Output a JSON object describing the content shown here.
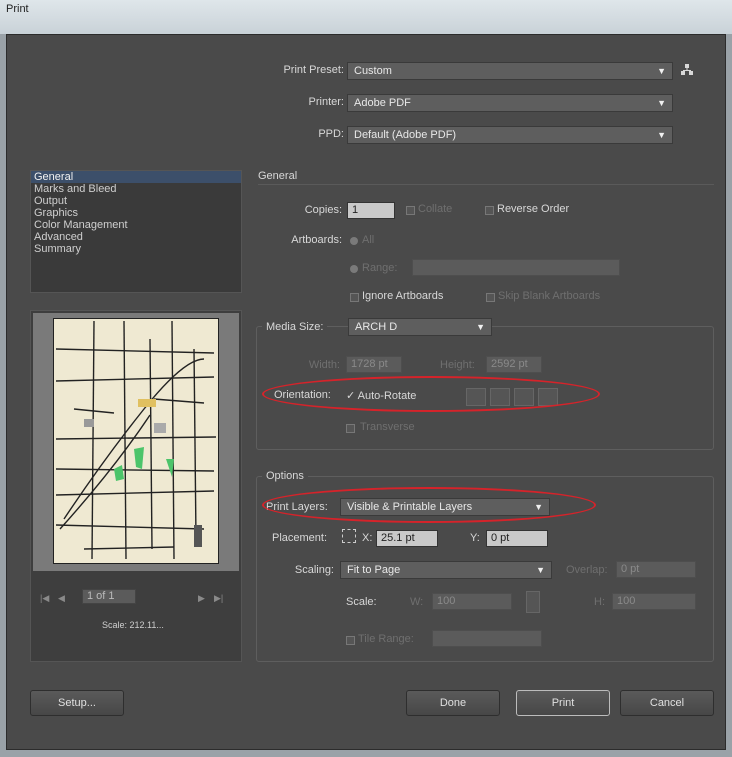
{
  "window": {
    "title": "Print"
  },
  "top": {
    "preset_label": "Print Preset:",
    "preset_value": "Custom",
    "printer_label": "Printer:",
    "printer_value": "Adobe PDF",
    "ppd_label": "PPD:",
    "ppd_value": "Default (Adobe PDF)"
  },
  "sidebar": {
    "items": [
      {
        "label": "General",
        "selected": true
      },
      {
        "label": "Marks and Bleed"
      },
      {
        "label": "Output"
      },
      {
        "label": "Graphics"
      },
      {
        "label": "Color Management"
      },
      {
        "label": "Advanced"
      },
      {
        "label": "Summary"
      }
    ]
  },
  "preview": {
    "page_indicator": "1 of 1",
    "scale_text": "Scale: 212.11..."
  },
  "general": {
    "heading": "General",
    "copies_label": "Copies:",
    "copies_value": "1",
    "collate_label": "Collate",
    "reverse_order_label": "Reverse Order",
    "artboards_label": "Artboards:",
    "all_label": "All",
    "range_label": "Range:",
    "ignore_artboards_label": "Ignore Artboards",
    "skip_blank_label": "Skip Blank Artboards"
  },
  "media": {
    "size_label": "Media Size:",
    "size_value": "ARCH D",
    "width_label": "Width:",
    "width_value": "1728 pt",
    "height_label": "Height:",
    "height_value": "2592 pt",
    "orientation_label": "Orientation:",
    "auto_rotate_label": "✓ Auto-Rotate",
    "transverse_label": "Transverse"
  },
  "options": {
    "heading": "Options",
    "print_layers_label": "Print Layers:",
    "print_layers_value": "Visible & Printable Layers",
    "placement_label": "Placement:",
    "x_label": "X:",
    "x_value": "25.1 pt",
    "y_label": "Y:",
    "y_value": "0 pt",
    "scaling_label": "Scaling:",
    "scaling_value": "Fit to Page",
    "overlap_label": "Overlap:",
    "overlap_value": "0 pt",
    "scale_label": "Scale:",
    "w_label": "W:",
    "w_value": "100",
    "h_label": "H:",
    "h_value": "100",
    "tile_range_label": "Tile Range:"
  },
  "buttons": {
    "setup": "Setup...",
    "done": "Done",
    "print": "Print",
    "cancel": "Cancel"
  },
  "colors": {
    "annotation": "#d6232a",
    "selection": "#3c4f6a"
  }
}
